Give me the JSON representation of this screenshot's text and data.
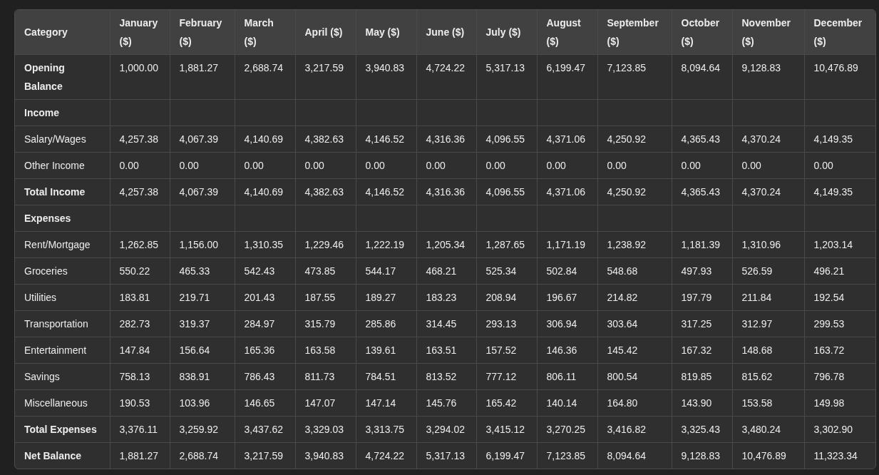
{
  "table": {
    "columns": [
      "Category",
      "January ($)",
      "February ($)",
      "March ($)",
      "April ($)",
      "May ($)",
      "June ($)",
      "July ($)",
      "August ($)",
      "September ($)",
      "October ($)",
      "November ($)",
      "December ($)"
    ],
    "rows": [
      {
        "kind": "total",
        "label": "Opening Balance",
        "values": [
          "1,000.00",
          "1,881.27",
          "2,688.74",
          "3,217.59",
          "3,940.83",
          "4,724.22",
          "5,317.13",
          "6,199.47",
          "7,123.85",
          "8,094.64",
          "9,128.83",
          "10,476.89"
        ]
      },
      {
        "kind": "section",
        "label": "Income"
      },
      {
        "kind": "item",
        "label": "Salary/Wages",
        "values": [
          "4,257.38",
          "4,067.39",
          "4,140.69",
          "4,382.63",
          "4,146.52",
          "4,316.36",
          "4,096.55",
          "4,371.06",
          "4,250.92",
          "4,365.43",
          "4,370.24",
          "4,149.35"
        ]
      },
      {
        "kind": "item",
        "label": "Other Income",
        "values": [
          "0.00",
          "0.00",
          "0.00",
          "0.00",
          "0.00",
          "0.00",
          "0.00",
          "0.00",
          "0.00",
          "0.00",
          "0.00",
          "0.00"
        ]
      },
      {
        "kind": "total",
        "label": "Total Income",
        "values": [
          "4,257.38",
          "4,067.39",
          "4,140.69",
          "4,382.63",
          "4,146.52",
          "4,316.36",
          "4,096.55",
          "4,371.06",
          "4,250.92",
          "4,365.43",
          "4,370.24",
          "4,149.35"
        ]
      },
      {
        "kind": "section",
        "label": "Expenses"
      },
      {
        "kind": "item",
        "label": "Rent/Mortgage",
        "values": [
          "1,262.85",
          "1,156.00",
          "1,310.35",
          "1,229.46",
          "1,222.19",
          "1,205.34",
          "1,287.65",
          "1,171.19",
          "1,238.92",
          "1,181.39",
          "1,310.96",
          "1,203.14"
        ]
      },
      {
        "kind": "item",
        "label": "Groceries",
        "values": [
          "550.22",
          "465.33",
          "542.43",
          "473.85",
          "544.17",
          "468.21",
          "525.34",
          "502.84",
          "548.68",
          "497.93",
          "526.59",
          "496.21"
        ]
      },
      {
        "kind": "item",
        "label": "Utilities",
        "values": [
          "183.81",
          "219.71",
          "201.43",
          "187.55",
          "189.27",
          "183.23",
          "208.94",
          "196.67",
          "214.82",
          "197.79",
          "211.84",
          "192.54"
        ]
      },
      {
        "kind": "item",
        "label": "Transportation",
        "values": [
          "282.73",
          "319.37",
          "284.97",
          "315.79",
          "285.86",
          "314.45",
          "293.13",
          "306.94",
          "303.64",
          "317.25",
          "312.97",
          "299.53"
        ]
      },
      {
        "kind": "item",
        "label": "Entertainment",
        "values": [
          "147.84",
          "156.64",
          "165.36",
          "163.58",
          "139.61",
          "163.51",
          "157.52",
          "146.36",
          "145.42",
          "167.32",
          "148.68",
          "163.72"
        ]
      },
      {
        "kind": "item",
        "label": "Savings",
        "values": [
          "758.13",
          "838.91",
          "786.43",
          "811.73",
          "784.51",
          "813.52",
          "777.12",
          "806.11",
          "800.54",
          "819.85",
          "815.62",
          "796.78"
        ]
      },
      {
        "kind": "item",
        "label": "Miscellaneous",
        "values": [
          "190.53",
          "103.96",
          "146.65",
          "147.07",
          "147.14",
          "145.76",
          "165.42",
          "140.14",
          "164.80",
          "143.90",
          "153.58",
          "149.98"
        ]
      },
      {
        "kind": "total",
        "label": "Total Expenses",
        "values": [
          "3,376.11",
          "3,259.92",
          "3,437.62",
          "3,329.03",
          "3,313.75",
          "3,294.02",
          "3,415.12",
          "3,270.25",
          "3,416.82",
          "3,325.43",
          "3,480.24",
          "3,302.90"
        ]
      },
      {
        "kind": "total",
        "label": "Net Balance",
        "values": [
          "1,881.27",
          "2,688.74",
          "3,217.59",
          "3,940.83",
          "4,724.22",
          "5,317.13",
          "6,199.47",
          "7,123.85",
          "8,094.64",
          "9,128.83",
          "10,476.89",
          "11,323.34"
        ]
      }
    ]
  }
}
